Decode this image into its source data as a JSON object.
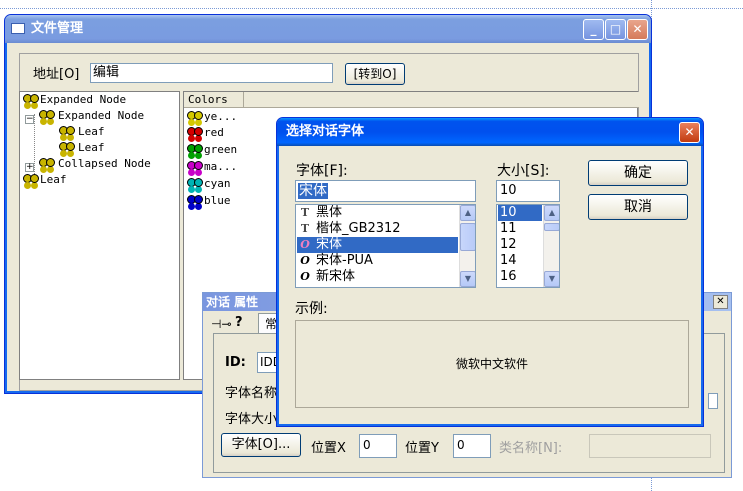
{
  "file_window": {
    "title": "文件管理",
    "address_label": "地址[O]",
    "address_value": "编辑",
    "goto_label": "[转到O]",
    "tree": [
      {
        "label": "Expanded Node",
        "color": "#c8b400"
      },
      {
        "label": "Expanded Node",
        "color": "#c8b400"
      },
      {
        "label": "Leaf",
        "color": "#c8b400"
      },
      {
        "label": "Leaf",
        "color": "#c8b400"
      },
      {
        "label": "Collapsed Node",
        "color": "#c8b400"
      },
      {
        "label": "Leaf",
        "color": "#c8b400"
      }
    ],
    "list_header": "Colors",
    "colors": [
      {
        "label": "ye...",
        "color": "#d4c800"
      },
      {
        "label": "red",
        "color": "#d40000"
      },
      {
        "label": "green",
        "color": "#00a000"
      },
      {
        "label": "ma...",
        "color": "#c800c8"
      },
      {
        "label": "cyan",
        "color": "#00b4b4"
      },
      {
        "label": "blue",
        "color": "#0000c8"
      }
    ]
  },
  "props_dialog": {
    "title": "对话 属性",
    "tab_general": "常",
    "id_label": "ID:",
    "id_value": "IDD",
    "font_name_label": "字体名称",
    "font_size_label": "字体大小",
    "font_button": "字体[O]...",
    "pos_x_label": "位置X",
    "pos_x_value": "0",
    "pos_y_label": "位置Y",
    "pos_y_value": "0",
    "class_label": "类名称[N]:",
    "close_glyph": "✕"
  },
  "font_dialog": {
    "title": "选择对话字体",
    "font_label": "字体[F]:",
    "font_value": "宋体",
    "size_label": "大小[S]:",
    "size_value": "10",
    "ok_label": "确定",
    "cancel_label": "取消",
    "fonts": [
      {
        "name": "黑体",
        "type": "TT"
      },
      {
        "name": "楷体_GB2312",
        "type": "TT"
      },
      {
        "name": "宋体",
        "type": "O",
        "selected": true
      },
      {
        "name": "宋体-PUA",
        "type": "O"
      },
      {
        "name": "新宋体",
        "type": "O"
      }
    ],
    "sizes": [
      {
        "value": "10",
        "selected": true
      },
      {
        "value": "11"
      },
      {
        "value": "12"
      },
      {
        "value": "14"
      },
      {
        "value": "16"
      }
    ],
    "sample_label": "示例:",
    "sample_text": "微软中文软件"
  }
}
